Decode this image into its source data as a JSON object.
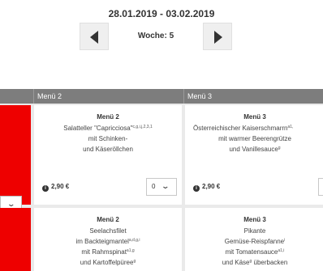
{
  "week_nav": {
    "date_range": "28.01.2019 - 03.02.2019",
    "week_label": "Woche: 5"
  },
  "table": {
    "columns": [
      "Menü 2",
      "Menü 3"
    ],
    "rows": [
      {
        "cells": [
          {
            "title": "Menü 2",
            "lines": [
              {
                "text": "Salatteller \"Capricciosa\"",
                "sup": "c,g,i,j,2,3,1"
              },
              {
                "text": "mit Schinken-",
                "sup": ""
              },
              {
                "text": "und Käseröllchen",
                "sup": ""
              }
            ],
            "price": "2,90 €",
            "quantity": "0"
          },
          {
            "title": "Menü 3",
            "lines": [
              {
                "text": "Österreichischer Kaiserschmarrn",
                "sup": "a1,"
              },
              {
                "text": "mit warmer Beerengrütze",
                "sup": ""
              },
              {
                "text": "und Vanillesauce",
                "sup": "g"
              }
            ],
            "price": "2,90 €"
          }
        ]
      },
      {
        "cells": [
          {
            "title": "Menü 2",
            "lines": [
              {
                "text": "Seelachsfilet",
                "sup": ""
              },
              {
                "text": "im Backteigmantel",
                "sup": "a,d,g,i"
              },
              {
                "text": "mit Rahmspinat",
                "sup": "a1,g"
              },
              {
                "text": "und Kartoffelpüree",
                "sup": "g"
              }
            ]
          },
          {
            "title": "Menü 3",
            "lines": [
              {
                "text": "Pikante",
                "sup": ""
              },
              {
                "text": "Gemüse-Reispfanne",
                "sup": "i"
              },
              {
                "text": "mit Tomatensauce",
                "sup": "a1,i"
              },
              {
                "text": "und Käse",
                "sup": "g"
              },
              {
                "text": " überbacken",
                "sup": ""
              }
            ]
          }
        ]
      }
    ]
  },
  "icons": {
    "info": "info-icon",
    "prev": "chevron-left-icon",
    "next": "chevron-right-icon",
    "dropdown": "chevron-down-icon"
  },
  "colors": {
    "accent_red": "#ee0000",
    "header_bg": "#7d7d7d",
    "grid_bg": "#eaeaea"
  }
}
